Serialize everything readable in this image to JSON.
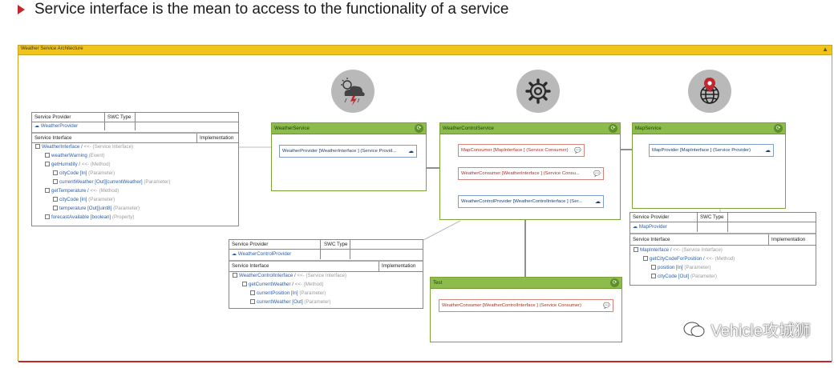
{
  "headline": "Service interface is the mean to access to the functionality of a service",
  "frame_title": "Weather Service Architecture",
  "icons": {
    "weather": "storm-cloud-icon",
    "control": "gear-icon",
    "map": "globe-pin-icon"
  },
  "weather_service": {
    "title": "WeatherService",
    "port": "WeatherProvider [WeatherInterface ] (Service Provid..."
  },
  "weather_control_service": {
    "title": "WeatherControlService",
    "ports": [
      "MapConsumer [MapInterface ] (Service Consumer)",
      "WeatherConsumer [WeatherInterface ] (Service Consu...",
      "WeatherControlProvider [WeatherControlInterface ] (Ser..."
    ]
  },
  "map_service": {
    "title": "MapService",
    "port": "MapProvider [MapInterface ] (Service Provider)"
  },
  "test": {
    "title": "Test",
    "port": "WeatherConsumer [WeatherControlInterface ] (Service Consumer)"
  },
  "weather_table": {
    "col1": "Service Provider",
    "col2": "SWC Type",
    "provider": "WeatherProvider",
    "iface_col": "Service Interface",
    "impl_col": "Implementation",
    "rows": [
      {
        "name": "WeatherInterface /",
        "meta": "<<- (Service Interface)"
      },
      {
        "name": "weatherWarning",
        "meta": "(Event)"
      },
      {
        "name": "getHumidity /",
        "meta": "<<- (Method)"
      },
      {
        "name": "cityCode [In]",
        "meta": "(Parameter)"
      },
      {
        "name": "currentWeather [Out][currentWeather]",
        "meta": "(Parameter)"
      },
      {
        "name": "getTemperature /",
        "meta": "<<- (Method)"
      },
      {
        "name": "cityCode [In]",
        "meta": "(Parameter)"
      },
      {
        "name": "temperature [Out][uint8]",
        "meta": "(Parameter)"
      },
      {
        "name": "forecastAvailable [boolean]",
        "meta": "(Property)"
      }
    ]
  },
  "control_table": {
    "col1": "Service Provider",
    "col2": "SWC Type",
    "provider": "WeatherControlProvider",
    "iface_col": "Service Interface",
    "impl_col": "Implementation",
    "rows": [
      {
        "name": "WeatherControlInterface /",
        "meta": "<<- (Service Interface)"
      },
      {
        "name": "getCurrentWeather /",
        "meta": "<<- (Method)"
      },
      {
        "name": "currentPosition [In]",
        "meta": "(Parameter)"
      },
      {
        "name": "currentWeather [Out]",
        "meta": "(Parameter)"
      }
    ]
  },
  "map_table": {
    "col1": "Service Provider",
    "col2": "SWC Type",
    "provider": "MapProvider",
    "iface_col": "Service Interface",
    "impl_col": "Implementation",
    "rows": [
      {
        "name": "MapInterface /",
        "meta": "<<- (Service Interface)"
      },
      {
        "name": "getCityCodeForPosition /",
        "meta": "<<- (Method)"
      },
      {
        "name": "position [In]",
        "meta": "(Parameter)"
      },
      {
        "name": "cityCode [Out]",
        "meta": "(Parameter)"
      }
    ]
  },
  "watermark": "Vehicle攻城狮",
  "colors": {
    "frame_header": "#f0c419",
    "service_header": "#8dbb4c",
    "accent_red": "#c0282d"
  }
}
